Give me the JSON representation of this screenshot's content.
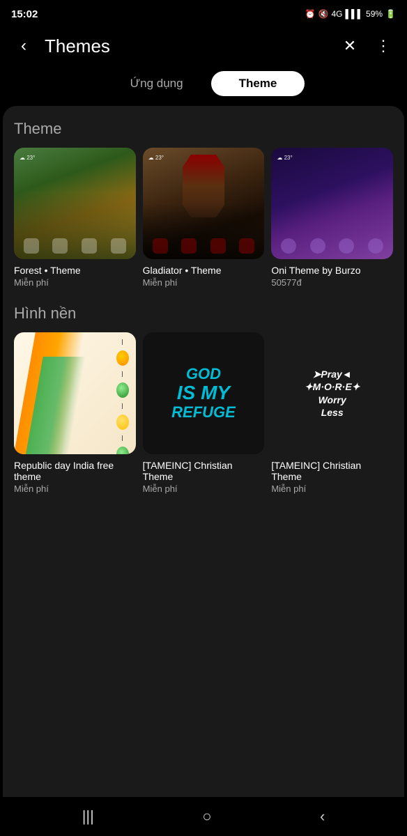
{
  "statusBar": {
    "time": "15:02",
    "battery": "59%",
    "network": "4G"
  },
  "header": {
    "title": "Themes",
    "backIcon": "‹",
    "closeIcon": "✕",
    "moreIcon": "⋮"
  },
  "tabs": [
    {
      "id": "ung-dung",
      "label": "Ứng dụng",
      "active": false
    },
    {
      "id": "theme",
      "label": "Theme",
      "active": true
    }
  ],
  "themeSection": {
    "title": "Theme",
    "items": [
      {
        "id": "forest",
        "name": "Forest • Theme",
        "price": "Miễn phí",
        "type": "forest"
      },
      {
        "id": "gladiator",
        "name": "Gladiator • Theme",
        "price": "Miễn phí",
        "type": "gladiator"
      },
      {
        "id": "oni",
        "name": "Oni Theme by Burzo",
        "price": "50577đ",
        "type": "oni"
      }
    ]
  },
  "wallpaperSection": {
    "title": "Hình nền",
    "items": [
      {
        "id": "republic",
        "name": "Republic day India free theme",
        "price": "Miễn phí",
        "type": "republic"
      },
      {
        "id": "god",
        "name": "[TAMEINC] Christian Theme",
        "price": "Miễn phí",
        "type": "god"
      },
      {
        "id": "pray",
        "name": "[TAMEINC] Christian Theme",
        "price": "Miễn phí",
        "type": "pray"
      }
    ]
  },
  "bottomNav": {
    "recentIcon": "|||",
    "homeIcon": "○",
    "backIcon": "‹"
  }
}
